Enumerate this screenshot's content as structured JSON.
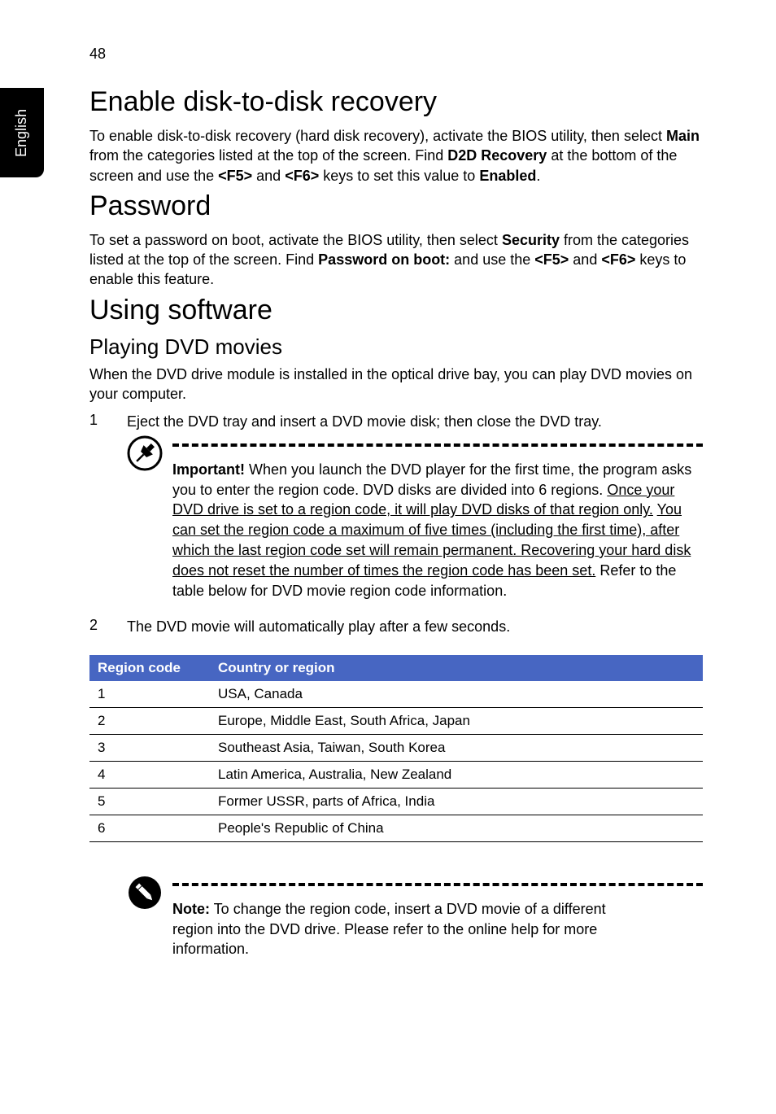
{
  "page_number": "48",
  "side_tab": "English",
  "sections": {
    "enable": {
      "heading": "Enable disk-to-disk recovery",
      "p1_a": "To enable disk-to-disk recovery (hard disk recovery), activate the BIOS utility, then select ",
      "p1_b": "Main",
      "p1_c": " from the categories listed at the top of the screen. Find ",
      "p1_d": "D2D Recovery",
      "p1_e": " at the bottom of the screen and use the ",
      "p1_f": "<F5>",
      "p1_g": " and ",
      "p1_h": "<F6>",
      "p1_i": " keys to set this value to ",
      "p1_j": "Enabled",
      "p1_k": "."
    },
    "password": {
      "heading": "Password",
      "p1_a": "To set a password on boot, activate the BIOS utility, then select ",
      "p1_b": "Security",
      "p1_c": " from the categories listed at the top of the screen. Find ",
      "p1_d": "Password on boot:",
      "p1_e": " and use the ",
      "p1_f": "<F5>",
      "p1_g": " and ",
      "p1_h": "<F6>",
      "p1_i": " keys to enable this feature."
    },
    "software": {
      "heading": "Using software",
      "sub": "Playing DVD movies",
      "p1": "When the DVD drive module is installed in the optical drive bay, you can play DVD movies on your computer.",
      "step1_num": "1",
      "step1_text": "Eject the DVD tray and insert a DVD movie disk; then close the DVD tray.",
      "important": {
        "lead": "Important!",
        "a": " When you launch the DVD player for the first time, the program asks you to enter the region code. DVD disks are divided into 6 regions. ",
        "u1": "Once your DVD drive is set to a region code, it will play DVD disks of that region only.",
        "mid": " ",
        "u2": "You can set the region code a maximum of five times (including the first time), after which the last region code set will remain permanent. Recovering your hard disk does not reset the number of times the region code has been set.",
        "b": " Refer to the table below for DVD movie region code information."
      },
      "step2_num": "2",
      "step2_text": "The DVD movie will automatically play after a few seconds."
    },
    "table": {
      "head1": "Region code",
      "head2": "Country or region",
      "rows": [
        {
          "code": "1",
          "region": "USA, Canada"
        },
        {
          "code": "2",
          "region": "Europe, Middle East, South Africa, Japan"
        },
        {
          "code": "3",
          "region": "Southeast Asia, Taiwan, South Korea"
        },
        {
          "code": "4",
          "region": "Latin America, Australia, New Zealand"
        },
        {
          "code": "5",
          "region": "Former USSR, parts of Africa, India"
        },
        {
          "code": "6",
          "region": "People's Republic of China"
        }
      ]
    },
    "note": {
      "lead": "Note:",
      "body": " To change the region code, insert a DVD movie of a different region into the DVD drive. Please refer to the online help for more information."
    }
  }
}
